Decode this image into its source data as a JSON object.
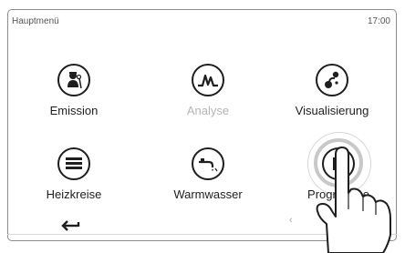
{
  "header": {
    "title": "Hauptmenü",
    "time": "17:00"
  },
  "tiles": [
    {
      "label": "Emission",
      "icon": "chimney-sweep-icon",
      "enabled": true
    },
    {
      "label": "Analyse",
      "icon": "analysis-waveform-icon",
      "enabled": true
    },
    {
      "label": "Visualisierung",
      "icon": "visualization-icon",
      "enabled": true
    },
    {
      "label": "Heizkreise",
      "icon": "radiator-icon",
      "enabled": true
    },
    {
      "label": "Warmwasser",
      "icon": "faucet-icon",
      "enabled": true
    },
    {
      "label": "Programme",
      "icon": "program-icon",
      "enabled": true
    }
  ],
  "footer": {
    "back_icon": "back-arrow-icon",
    "prev_icon": "chevron-left-icon",
    "prev_glyph": "‹"
  },
  "overlay": {
    "pointer": "pointing-hand-icon"
  },
  "colors": {
    "accent": "#1e1e1e",
    "disabled": "#b5b5b5",
    "ripple": "#c8c8c8"
  }
}
